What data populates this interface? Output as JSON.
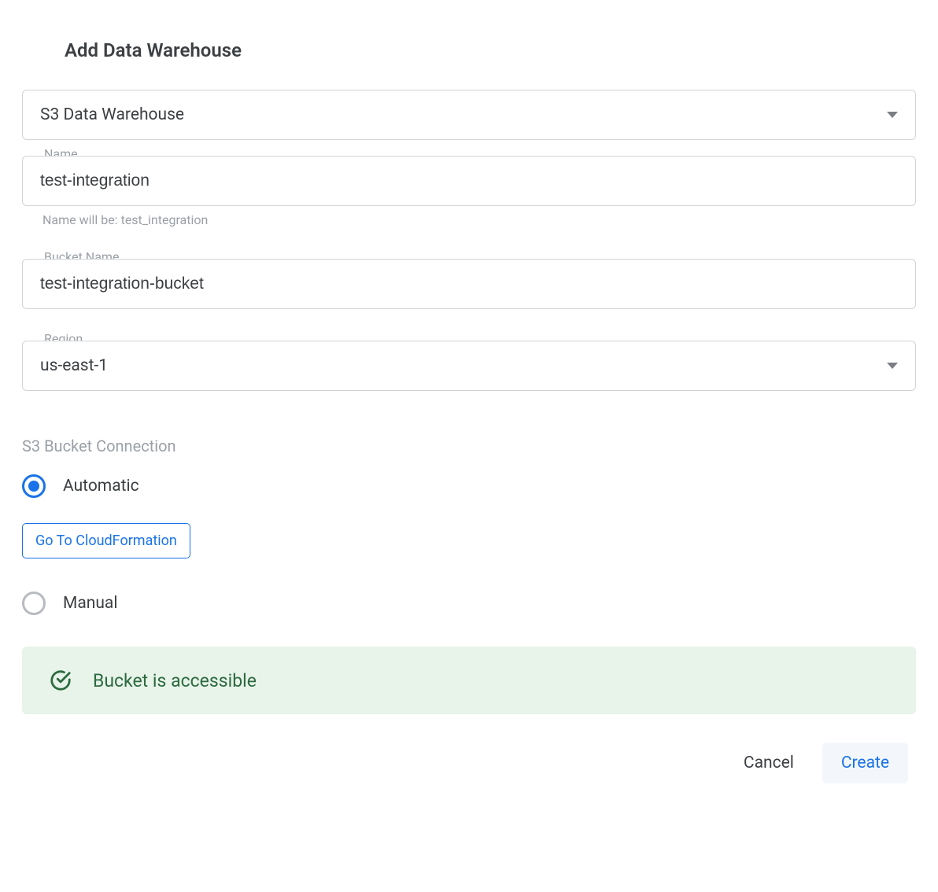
{
  "title": "Add Data Warehouse",
  "warehouse_type": {
    "selected": "S3 Data Warehouse"
  },
  "name_field": {
    "label": "Name",
    "value": "test-integration",
    "helper": "Name will be: test_integration"
  },
  "bucket_field": {
    "label": "Bucket Name",
    "value": "test-integration-bucket"
  },
  "region_field": {
    "label": "Region",
    "selected": "us-east-1"
  },
  "connection": {
    "section_label": "S3 Bucket Connection",
    "option_automatic": "Automatic",
    "option_manual": "Manual",
    "cloudformation_button": "Go To CloudFormation"
  },
  "status": {
    "message": "Bucket is accessible"
  },
  "actions": {
    "cancel": "Cancel",
    "create": "Create"
  }
}
